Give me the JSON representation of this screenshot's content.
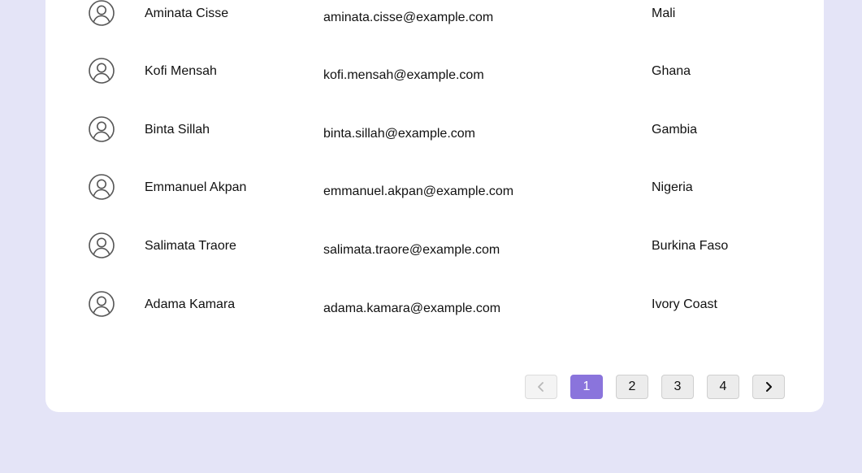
{
  "users": [
    {
      "name": "Aminata Cisse",
      "email": "aminata.cisse@example.com",
      "country": "Mali"
    },
    {
      "name": "Kofi Mensah",
      "email": "kofi.mensah@example.com",
      "country": "Ghana"
    },
    {
      "name": "Binta Sillah",
      "email": "binta.sillah@example.com",
      "country": "Gambia"
    },
    {
      "name": "Emmanuel Akpan",
      "email": "emmanuel.akpan@example.com",
      "country": "Nigeria"
    },
    {
      "name": "Salimata Traore",
      "email": "salimata.traore@example.com",
      "country": "Burkina Faso"
    },
    {
      "name": "Adama Kamara",
      "email": "adama.kamara@example.com",
      "country": "Ivory Coast"
    }
  ],
  "pagination": {
    "pages": [
      "1",
      "2",
      "3",
      "4"
    ],
    "current_page": "1",
    "prev_icon": "chevron-left-icon",
    "next_icon": "chevron-right-icon"
  },
  "colors": {
    "page_background": "#e4e4f7",
    "card_background": "#ffffff",
    "accent": "#8a74dc"
  }
}
